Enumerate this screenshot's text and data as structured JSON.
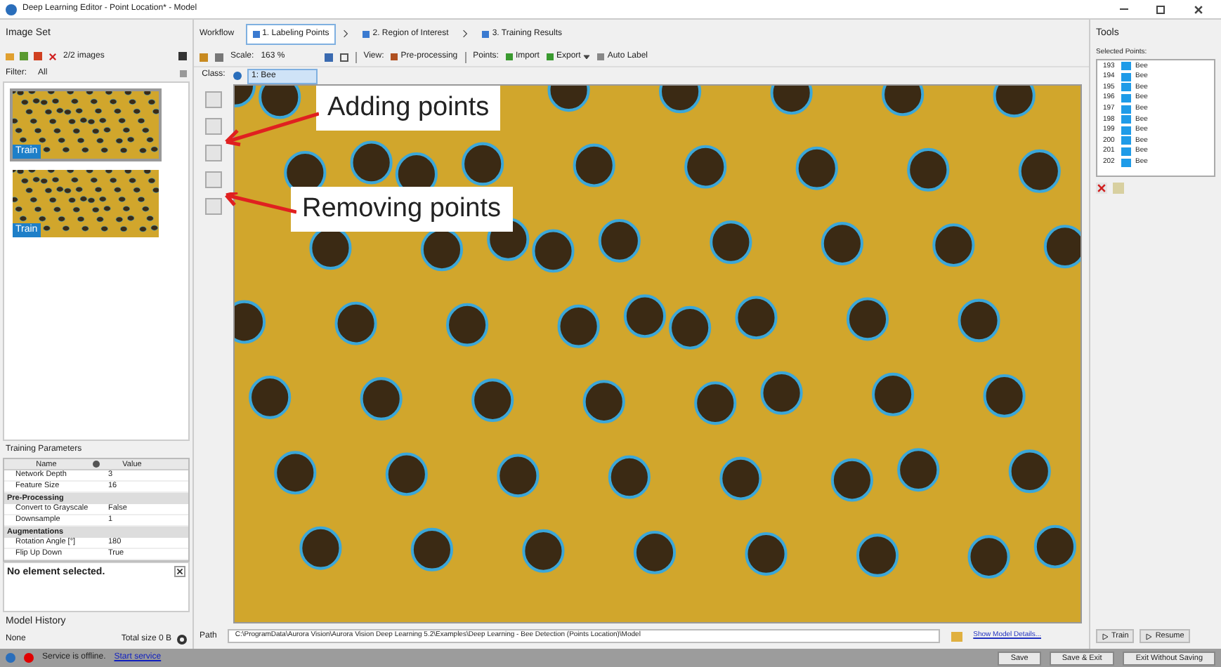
{
  "window": {
    "title": "Deep Learning Editor - Point Location* - Model"
  },
  "image_set": {
    "title": "Image Set",
    "count": "2/2 images",
    "filter_label": "Filter:",
    "filter_value": "All",
    "thumbnails": [
      {
        "label": "Train",
        "selected": true
      },
      {
        "label": "Train",
        "selected": false
      }
    ]
  },
  "training_parameters": {
    "title": "Training Parameters",
    "columns": [
      "Name",
      "Value"
    ],
    "rows": [
      {
        "kind": "param",
        "name": "Network Depth",
        "value": "3"
      },
      {
        "kind": "param",
        "name": "Feature Size",
        "value": "16"
      },
      {
        "kind": "section",
        "name": "Pre-Processing"
      },
      {
        "kind": "param",
        "name": "Convert to Grayscale",
        "value": "False"
      },
      {
        "kind": "param",
        "name": "Downsample",
        "value": "1"
      },
      {
        "kind": "section",
        "name": "Augmentations"
      },
      {
        "kind": "param",
        "name": "Rotation Angle [°]",
        "value": "180"
      },
      {
        "kind": "param",
        "name": "Flip Up Down",
        "value": "True"
      }
    ]
  },
  "properties": {
    "message": "No element selected."
  },
  "model_history": {
    "title": "Model History",
    "value": "None",
    "total": "Total size 0 B"
  },
  "workflow": {
    "label": "Workflow",
    "steps": [
      {
        "label": "1. Labeling Points",
        "selected": true
      },
      {
        "label": "2. Region of Interest",
        "selected": false
      },
      {
        "label": "3. Training Results",
        "selected": false
      }
    ]
  },
  "toolbar": {
    "scale_label": "Scale:",
    "scale": "163 %",
    "view_label": "View:",
    "preprocessing": "Pre-processing",
    "points_label": "Points:",
    "import": "Import",
    "export": "Export",
    "auto_label": "Auto Label"
  },
  "class_bar": {
    "label": "Class:",
    "value": "1: Bee"
  },
  "callouts": [
    "Adding points",
    "Removing points"
  ],
  "tools": {
    "title": "Tools",
    "selected_label": "Selected Points:",
    "points": [
      {
        "id": "193",
        "label": "Bee"
      },
      {
        "id": "194",
        "label": "Bee"
      },
      {
        "id": "195",
        "label": "Bee"
      },
      {
        "id": "196",
        "label": "Bee"
      },
      {
        "id": "197",
        "label": "Bee"
      },
      {
        "id": "198",
        "label": "Bee"
      },
      {
        "id": "199",
        "label": "Bee"
      },
      {
        "id": "200",
        "label": "Bee"
      },
      {
        "id": "201",
        "label": "Bee"
      },
      {
        "id": "202",
        "label": "Bee"
      }
    ]
  },
  "path": {
    "label": "Path",
    "value": "C:\\ProgramData\\Aurora Vision\\Aurora Vision Deep Learning 5.2\\Examples\\Deep Learning - Bee Detection (Points Location)\\Model",
    "link": "Show Model Details..."
  },
  "train_buttons": [
    "Train",
    "Resume"
  ],
  "status": {
    "message": "Service is offline.",
    "link": "Start service",
    "buttons": [
      "Save",
      "Save & Exit",
      "Exit Without Saving"
    ]
  }
}
